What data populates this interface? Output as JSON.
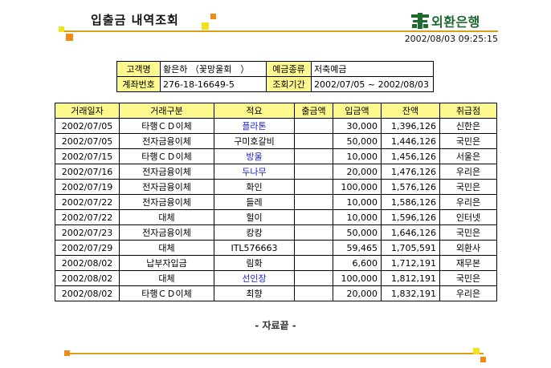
{
  "header": {
    "title": "입출금 내역조회",
    "logo_text": "외환은행",
    "timestamp": "2002/08/03 09:25:15"
  },
  "info": {
    "customer_label": "고객명",
    "customer_value": "황은하 （꽃망울회　）",
    "deposit_type_label": "예금종류",
    "deposit_type_value": "저축예금",
    "account_label": "계좌번호",
    "account_value": "276-18-16649-5",
    "period_label": "조회기간",
    "period_value": "2002/07/05 ~ 2002/08/03"
  },
  "table": {
    "headers": [
      "거래일자",
      "거래구분",
      "적요",
      "출금액",
      "입금액",
      "잔액",
      "취급점"
    ],
    "rows": [
      {
        "date": "2002/07/05",
        "type": "타행ＣＤ이체",
        "memo": "플라톤",
        "out": "",
        "in": "30,000",
        "balance": "1,396,126",
        "branch": "신한은",
        "link": true
      },
      {
        "date": "2002/07/05",
        "type": "전자금융이체",
        "memo": "구미호갈비",
        "out": "",
        "in": "50,000",
        "balance": "1,446,126",
        "branch": "국민은",
        "link": false
      },
      {
        "date": "2002/07/15",
        "type": "타행ＣＤ이체",
        "memo": "방울",
        "out": "",
        "in": "10,000",
        "balance": "1,456,126",
        "branch": "서울은",
        "link": true
      },
      {
        "date": "2002/07/16",
        "type": "전자금융이체",
        "memo": "두나무",
        "out": "",
        "in": "20,000",
        "balance": "1,476,126",
        "branch": "우리은",
        "link": true
      },
      {
        "date": "2002/07/19",
        "type": "전자금융이체",
        "memo": "화인",
        "out": "",
        "in": "100,000",
        "balance": "1,576,126",
        "branch": "국민은",
        "link": false
      },
      {
        "date": "2002/07/22",
        "type": "전자금융이체",
        "memo": "들레",
        "out": "",
        "in": "10,000",
        "balance": "1,586,126",
        "branch": "우리은",
        "link": false
      },
      {
        "date": "2002/07/22",
        "type": "대체",
        "memo": "헐이",
        "out": "",
        "in": "10,000",
        "balance": "1,596,126",
        "branch": "인터넷",
        "link": false
      },
      {
        "date": "2002/07/23",
        "type": "전자금융이체",
        "memo": "캉캉",
        "out": "",
        "in": "50,000",
        "balance": "1,646,126",
        "branch": "국민은",
        "link": false
      },
      {
        "date": "2002/07/29",
        "type": "대체",
        "memo": "ITL576663",
        "out": "",
        "in": "59,465",
        "balance": "1,705,591",
        "branch": "외환사",
        "link": false
      },
      {
        "date": "2002/08/02",
        "type": "납부자입금",
        "memo": "림화",
        "out": "",
        "in": "6,600",
        "balance": "1,712,191",
        "branch": "재무본",
        "link": false
      },
      {
        "date": "2002/08/02",
        "type": "대체",
        "memo": "선인장",
        "out": "",
        "in": "100,000",
        "balance": "1,812,191",
        "branch": "국민은",
        "link": true
      },
      {
        "date": "2002/08/02",
        "type": "타행ＣＤ이체",
        "memo": "최향",
        "out": "",
        "in": "20,000",
        "balance": "1,832,191",
        "branch": "우리은",
        "link": false
      }
    ]
  },
  "footer": {
    "note": "- 자료끝 -"
  },
  "colors": {
    "header_fill": "#fef98e",
    "accent_line": "#d8a018",
    "link_text": "#1a22c8",
    "logo_green": "#1d6a2e"
  }
}
